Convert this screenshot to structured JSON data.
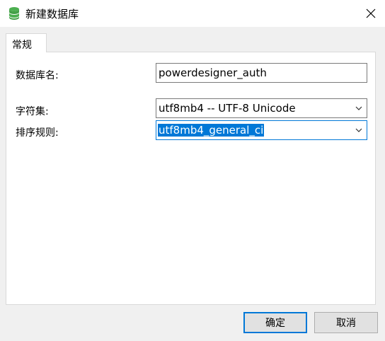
{
  "window": {
    "title": "新建数据库"
  },
  "tabs": [
    {
      "label": "常规"
    }
  ],
  "form": {
    "db_name_label": "数据库名:",
    "db_name_value": "powerdesigner_auth",
    "charset_label": "字符集:",
    "charset_value": "utf8mb4 -- UTF-8 Unicode",
    "collation_label": "排序规则:",
    "collation_value": "utf8mb4_general_ci"
  },
  "buttons": {
    "ok_label": "确定",
    "cancel_label": "取消"
  },
  "colors": {
    "accent": "#0078d7",
    "icon_green": "#4caf50"
  },
  "icons": {
    "app": "database-icon",
    "close": "close-icon",
    "dropdown": "chevron-down-icon"
  }
}
